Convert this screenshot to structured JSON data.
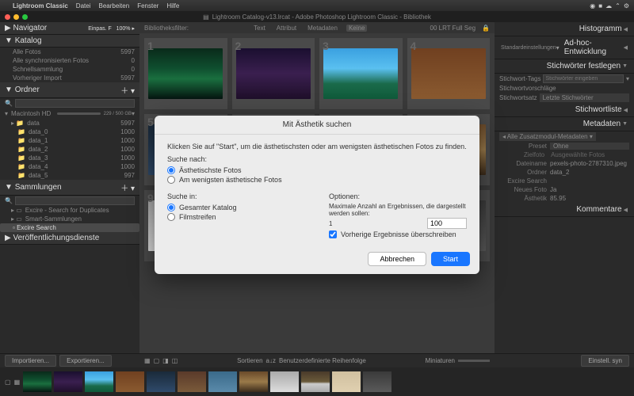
{
  "menubar": {
    "app": "Lightroom Classic",
    "items": [
      "Datei",
      "Bearbeiten",
      "Fenster",
      "Hilfe"
    ]
  },
  "window": {
    "title": "Lightroom Catalog-v13.lrcat - Adobe Photoshop Lightroom Classic - Bibliothek"
  },
  "left": {
    "navigator": {
      "title": "Navigator",
      "fit": "Einpas. F",
      "zoom": "100%"
    },
    "katalog": {
      "title": "Katalog",
      "rows": [
        {
          "label": "Alle Fotos",
          "count": "5997"
        },
        {
          "label": "Alle synchronisierten Fotos",
          "count": "0"
        },
        {
          "label": "Schnellsammlung",
          "count": "0"
        },
        {
          "label": "Vorheriger Import",
          "count": "5997"
        }
      ]
    },
    "ordner": {
      "title": "Ordner",
      "volume": "Macintosh HD",
      "usage": "229 / 500 GB",
      "folders": [
        {
          "label": "data",
          "count": "5997"
        },
        {
          "label": "data_0",
          "count": "1000"
        },
        {
          "label": "data_1",
          "count": "1000"
        },
        {
          "label": "data_2",
          "count": "1000"
        },
        {
          "label": "data_3",
          "count": "1000"
        },
        {
          "label": "data_4",
          "count": "1000"
        },
        {
          "label": "data_5",
          "count": "997"
        }
      ]
    },
    "sammlungen": {
      "title": "Sammlungen",
      "items": [
        {
          "label": "Excire - Search for Duplicates"
        },
        {
          "label": "Smart-Sammlungen"
        },
        {
          "label": "Excire Search"
        }
      ]
    },
    "pub": {
      "title": "Veröffentlichungsdienste"
    }
  },
  "right": {
    "histogram": "Histogramm",
    "adhoc": "Ad-hoc-Entwicklung",
    "adhoc_pre": "Standardeinstellungen",
    "stichfest": "Stichwörter festlegen",
    "stich_tags": "Stichwort-Tags",
    "stich_ph": "Stichwörter eingeben",
    "stich_vor": "Stichwortvorschläge",
    "stich_satz": "Stichwortsatz",
    "stich_satz_val": "Letzte Stichwörter",
    "stichliste": "Stichwortliste",
    "metadaten": "Metadaten",
    "meta_filter": "Alle Zusatzmodul-Metadaten",
    "preset": "Preset",
    "preset_val": "Ohne",
    "tabs": {
      "a": "Zielfoto",
      "b": "Ausgewählte Fotos"
    },
    "meta_rows": [
      {
        "k": "Dateiname",
        "v": "pexels-photo-2787310.jpeg"
      },
      {
        "k": "Ordner",
        "v": "data_2"
      },
      {
        "k": "Excire Search",
        "v": ""
      },
      {
        "k": "Neues Foto",
        "v": "Ja"
      },
      {
        "k": "Ästhetik",
        "v": "85.95"
      }
    ],
    "kommentare": "Kommentare"
  },
  "filter": {
    "label": "Bibliotheksfilter:",
    "tabs": [
      "Text",
      "Attribut",
      "Metadaten",
      "Keine"
    ],
    "preset": "00 LRT Full Seg"
  },
  "toolbar": {
    "import": "Importieren...",
    "export": "Exportieren...",
    "sort": "Sortieren",
    "order": "Benutzerdefinierte Reihenfolge",
    "thumbs": "Miniaturen",
    "sync": "Einstell. syn"
  },
  "dialog": {
    "title": "Mit Ästhetik suchen",
    "intro": "Klicken Sie auf \"Start\", um die ästhetischsten oder am wenigsten ästhetischen Fotos zu finden.",
    "suche_nach": "Suche nach:",
    "opt1": "Ästhetischste Fotos",
    "opt2": "Am wenigsten ästhetische Fotos",
    "suche_in": "Suche in:",
    "in1": "Gesamter Katalog",
    "in2": "Filmstreifen",
    "optionen": "Optionen:",
    "max_label": "Maximale Anzahl an Ergebnissen, die dargestellt werden sollen:",
    "max_val": "100",
    "overwrite": "Vorherige Ergebnisse überschreiben",
    "cancel": "Abbrechen",
    "start": "Start"
  },
  "thumbs": [
    "linear-gradient(#0a2a1a,#0f4f2f 40%,#1a6f3f 60%,#051510)",
    "linear-gradient(#1a0f2f,#3a1f4f 50%,#1f0f2a)",
    "linear-gradient(#3aa0e0,#5ac0f0 40%,#1a6a4a 70%,#0f5a3a)",
    "linear-gradient(#704020,#8a5a30)",
    "linear-gradient(#1a2a3a,#2f4a6a)",
    "linear-gradient(#5a3a2a,#7a5a3a)",
    "linear-gradient(#3a6a8a,#5a8aaa)",
    "linear-gradient(#6a4a2a,#9a7a4a 50%,#3a2a1a)",
    "linear-gradient(#aaa,#ddd)",
    "linear-gradient(#4a3a2a,#6a5a3a 50%,#ccc 60%,#aaa)",
    "linear-gradient(#d0c0a0,#e0d0b0)",
    "linear-gradient(#3a3a3a,#5a5a5a)"
  ]
}
